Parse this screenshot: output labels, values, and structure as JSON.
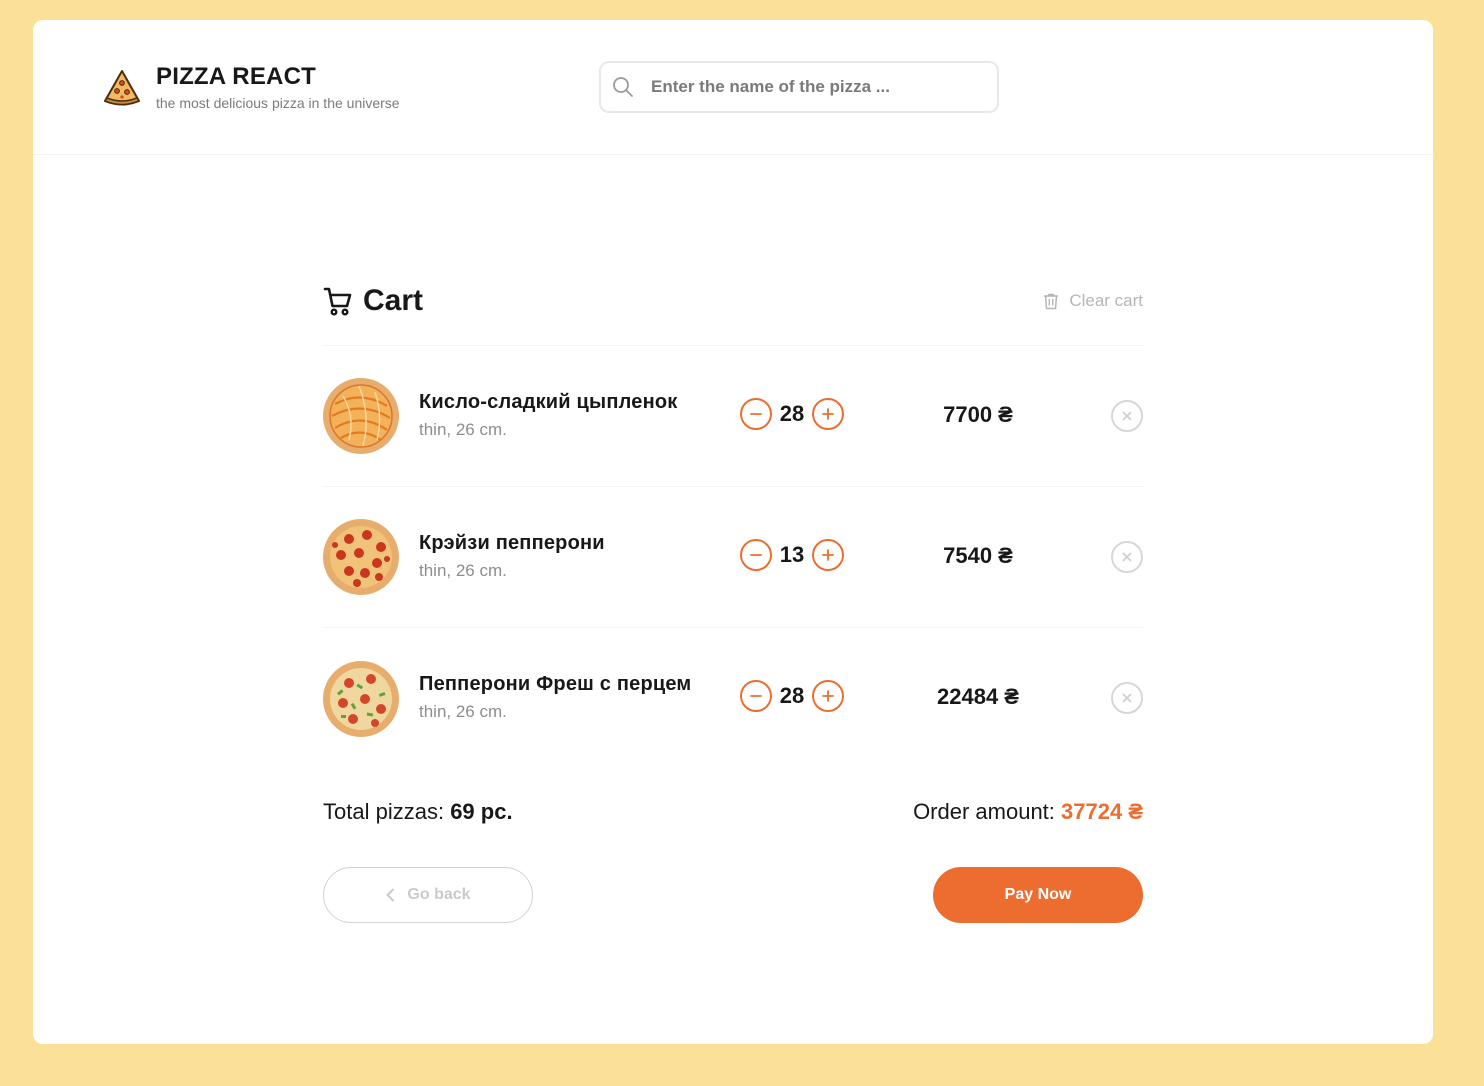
{
  "header": {
    "title": "PIZZA REACT",
    "subtitle": "the most delicious pizza in the universe",
    "search_placeholder": "Enter the name of the pizza ..."
  },
  "cart": {
    "title": "Cart",
    "clear_label": "Clear cart",
    "items": [
      {
        "name": "Кисло-сладкий цыпленок",
        "details": "thin, 26 cm.",
        "count": "28",
        "price": "7700 ₴",
        "topping": "chicken"
      },
      {
        "name": "Крэйзи пепперони",
        "details": "thin, 26 cm.",
        "count": "13",
        "price": "7540 ₴",
        "topping": "pepperoni"
      },
      {
        "name": "Пепперони Фреш с перцем",
        "details": "thin, 26 cm.",
        "count": "28",
        "price": "22484 ₴",
        "topping": "pepper"
      }
    ],
    "total_label": "Total pizzas:",
    "total_value": "69 pc.",
    "order_label": "Order amount:",
    "order_value": "37724 ₴",
    "go_back_label": "Go back",
    "pay_label": "Pay Now"
  },
  "colors": {
    "background": "#fbe098",
    "accent": "#ec6d2f"
  }
}
